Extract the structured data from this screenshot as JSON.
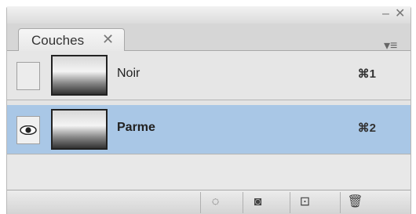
{
  "panel": {
    "tab_label": "Couches",
    "tab_close_icon": "close-icon",
    "minimize_glyph": "–",
    "close_glyph": "✕",
    "menu_glyph": "▾≡"
  },
  "layers": [
    {
      "name": "Noir",
      "shortcut": "⌘1",
      "visible": false,
      "selected": false
    },
    {
      "name": "Parme",
      "shortcut": "⌘2",
      "visible": true,
      "selected": true
    }
  ],
  "footer": {
    "buttons": [
      {
        "icon": "dotted-circle-icon",
        "glyph": "◌"
      },
      {
        "icon": "save-selection-icon",
        "glyph": "◙"
      },
      {
        "icon": "new-channel-icon",
        "glyph": "⊡"
      },
      {
        "icon": "trash-icon",
        "glyph": "🗑"
      }
    ]
  },
  "colors": {
    "selected_row": "#a9c7e6",
    "panel_bg": "#e4e4e4"
  }
}
